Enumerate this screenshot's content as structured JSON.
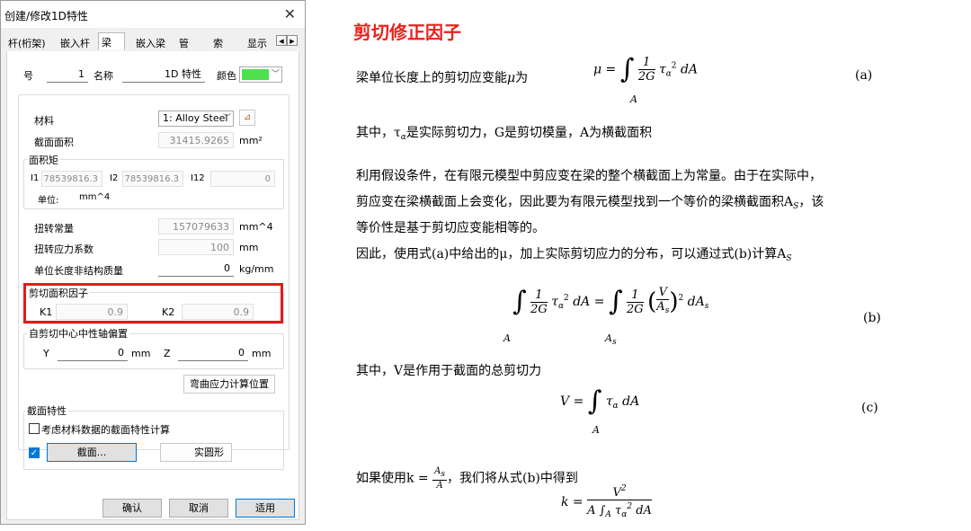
{
  "dialog": {
    "title": "创建/修改1D特性",
    "close": "✕",
    "tabs": [
      "杆(桁架)",
      "嵌入杆",
      "梁",
      "嵌入梁",
      "管",
      "索",
      "显示"
    ],
    "number_label": "号",
    "number_value": "1",
    "name_label": "名称",
    "name_value": "1D 特性",
    "color_label": "颜色",
    "color_value": "#4de14d",
    "material_label": "材料",
    "material_value": "1: Alloy Steel",
    "area_label": "截面面积",
    "area_value": "31415.9265",
    "area_unit": "mm²",
    "inertia_group": "面积矩",
    "i1_label": "I1",
    "i1_value": "78539816.3",
    "i2_label": "I2",
    "i2_value": "78539816.3",
    "i12_label": "I12",
    "i12_value": "0",
    "unit_label": "单位:",
    "unit_value": "mm^4",
    "torsion_label": "扭转常量",
    "torsion_value": "157079633",
    "torsion_unit": "mm^4",
    "torsion_stress_label": "扭转应力系数",
    "torsion_stress_value": "100",
    "torsion_stress_unit": "mm",
    "mass_label": "单位长度非结构质量",
    "mass_value": "0",
    "mass_unit": "kg/mm",
    "shear_group": "剪切面积因子",
    "k1_label": "K1",
    "k1_value": "0.9",
    "k2_label": "K2",
    "k2_value": "0.9",
    "offset_group": "自剪切中心中性轴偏置",
    "y_label": "Y",
    "y_value": "0",
    "y_unit": "mm",
    "z_label": "Z",
    "z_value": "0",
    "z_unit": "mm",
    "bending_button": "弯曲应力计算位置",
    "section_group": "截面特性",
    "consider_label": "考虑材料数据的截面特性计算",
    "section_button": "截面...",
    "solid_button": "实圆形",
    "ok": "确认",
    "cancel": "取消",
    "apply": "适用"
  },
  "doc": {
    "title": "剪切修正因子",
    "line1": "梁单位长度上的剪切应变能",
    "mu": "μ",
    "line1_tail": "为",
    "eq_a_tag": "(a)",
    "line2": "其中，τ",
    "line2_b": "是实际剪切力，G是剪切模量，A为横截面积",
    "para1": "利用假设条件，在有限元模型中剪应变在梁的整个横截面上为常量。由于在实际中，",
    "para2": "剪应变在梁横截面上会变化，因此要为有限元模型找到一个等价的梁横截面积A",
    "para2_tail": "，该",
    "para3": "等价性是基于剪切应变能相等的。",
    "para4": "因此，使用式(a)中给出的μ，加上实际剪切应力的分布，可以通过式(b)计算A",
    "eq_b_tag": "(b)",
    "line5": "其中，V是作用于截面的总剪切力",
    "eq_c_tag": "(c)",
    "line6a": "如果使用k =",
    "line6b": "，我们将从式(b)中得到"
  }
}
